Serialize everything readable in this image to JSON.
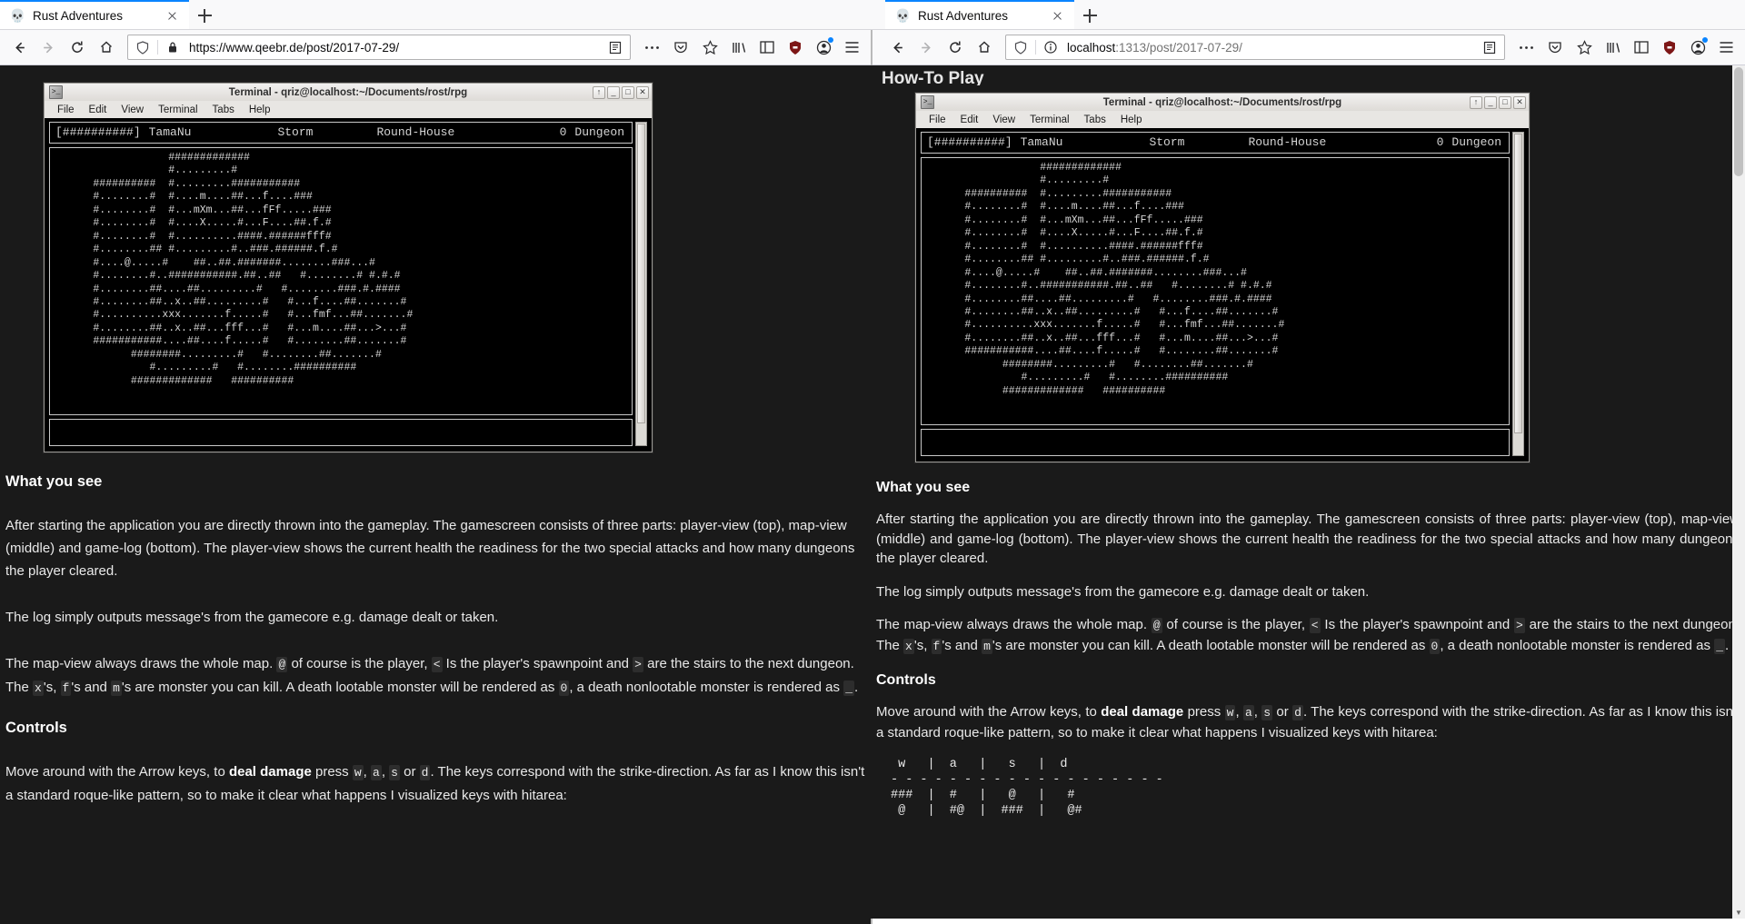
{
  "windows": {
    "left": {
      "tab": {
        "title": "Rust Adventures",
        "favicon": "skull-icon",
        "close_label": "×"
      },
      "newtab_label": "+",
      "url": {
        "scheme": "https://",
        "host": "www.qeebr.de",
        "path": "/post/2017-07-29/"
      },
      "url_full": "https://www.qeebr.de/post/2017-07-29/",
      "shield_icon": "shield-icon",
      "lock_icon": "padlock-icon",
      "reader_icon": "reader-view-icon",
      "menu_icons": [
        "library-icon",
        "sidebar-icon",
        "ublock-icon",
        "container-icon",
        "hamburger-icon"
      ],
      "nav": {
        "back": "←",
        "forward": "→",
        "reload": "↻",
        "home": "⌂"
      },
      "page_heading_visible": ""
    },
    "right": {
      "tab": {
        "title": "Rust Adventures",
        "favicon": "skull-icon",
        "close_label": "×"
      },
      "newtab_label": "+",
      "url": {
        "scheme": "",
        "host": "localhost",
        "path": ":1313/post/2017-07-29/"
      },
      "url_full": "localhost:1313/post/2017-07-29/",
      "shield_icon": "shield-icon",
      "info_icon": "info-circle-icon",
      "reader_icon": "reader-view-icon",
      "menu_icons": [
        "library-icon",
        "sidebar-icon",
        "ublock-icon",
        "container-icon",
        "hamburger-icon"
      ],
      "nav": {
        "back": "←",
        "forward": "→",
        "reload": "↻",
        "home": "⌂"
      },
      "page_heading_visible": "How-To Play"
    }
  },
  "terminal": {
    "title": "Terminal - qriz@localhost:~/Documents/rost/rpg",
    "icon": "terminal-icon",
    "window_buttons": {
      "shade": "↑",
      "minimize": "_",
      "maximize": "□",
      "close": "✕"
    },
    "menu": [
      "File",
      "Edit",
      "View",
      "Terminal",
      "Tabs",
      "Help"
    ],
    "status": {
      "health_bar": "[##########]",
      "player_name": "TamaNu",
      "attack_1": "Storm",
      "attack_2": "Round-House",
      "dungeon_count": "0",
      "dungeon_label": "Dungeon"
    },
    "map_lines": [
      "                  #############",
      "                  #.........#",
      "      ##########  #.........###########",
      "      #........#  #....m....##...f....###",
      "      #........#  #...mXm...##...fFf.....###",
      "      #........#  #....X.....#...F....##.f.#",
      "      #........#  #..........####.######fff#",
      "      #........## #.........#..###.######.f.#",
      "      #....@.....#    ##..##.#######........###...#",
      "      #........#..###########.##..##   #........# #.#.#",
      "      #........##....##.........#   #........###.#.####",
      "      #........##..x..##.........#   #...f....##.......#",
      "      #..........xxx.......f.....#   #...fmf...##.......#",
      "      #........##..x..##...fff...#   #...m....##...>...#",
      "      ###########....##....f.....#   #........##.......#",
      "            ########.........#   #........##.......#",
      "               #.........#   #........##########",
      "            #############   ##########"
    ]
  },
  "article": {
    "sections": [
      {
        "id": "what-you-see",
        "heading": "What you see"
      },
      {
        "id": "controls",
        "heading": "Controls"
      }
    ],
    "p1": "After starting the application you are directly thrown into the gameplay. The gamescreen consists of three parts: player-view (top), map-view (middle) and game-log (bottom). The player-view shows the current health the readiness for the two special attacks and how many dungeons the player cleared.",
    "p2": "The log simply outputs message's from the gamecore e.g. damage dealt or taken.",
    "p3_a": "The map-view always draws the whole map. ",
    "p3_at": "@",
    "p3_b": " of course is the player, ",
    "p3_lt": "<",
    "p3_c": " Is the player's spawnpoint and ",
    "p3_gt": ">",
    "p3_d": " are the stairs to the next dungeon. The ",
    "p3_x": "x",
    "p3_e": "'s, ",
    "p3_f": "f",
    "p3_g": "'s and ",
    "p3_m": "m",
    "p3_h": "'s are monster you can kill. A death lootable monster will be rendered as ",
    "p3_zero": "0",
    "p3_i": ", a death nonlootable monster is rendered as ",
    "p3_us": "_",
    "p3_j": ".",
    "p4_a": "Move around with the Arrow keys, to ",
    "p4_bold": "deal damage",
    "p4_b": " press ",
    "p4_w": "w",
    "p4_c": ", ",
    "p4_aa": "a",
    "p4_d": ", ",
    "p4_s": "s",
    "p4_e": " or ",
    "p4_dd": "d",
    "p4_f": ". The keys correspond with the strike-direction. As far as I know this isn't a standard roque-like pattern, so to make it clear what happens I visualized keys with hitarea:",
    "controls_table": [
      " w   |  a   |   s   |  d",
      "- - - - - - - - - - - - - - - - - - -",
      "###  |  #   |   @   |   #",
      " @   |  #@  |  ###  |   @#"
    ]
  }
}
